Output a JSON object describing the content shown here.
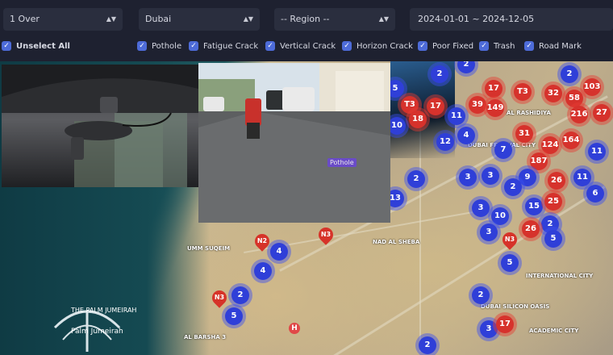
{
  "filters": {
    "severity": "1 Over",
    "city": "Dubai",
    "region": "-- Region --",
    "date_range": "2024-01-01 ~ 2024-12-05"
  },
  "checkboxes": [
    {
      "label": "Unselect All",
      "checked": true
    },
    {
      "label": "Pothole",
      "checked": true
    },
    {
      "label": "Fatigue Crack",
      "checked": true
    },
    {
      "label": "Vertical Crack",
      "checked": true
    },
    {
      "label": "Horizon Crack",
      "checked": true
    },
    {
      "label": "Poor Fixed",
      "checked": true
    },
    {
      "label": "Trash",
      "checked": true
    },
    {
      "label": "Road Mark",
      "checked": true
    }
  ],
  "video": {
    "detection_label": "Pothole"
  },
  "map": {
    "labels": [
      "THE PALM JUMEIRAH",
      "Palm Jumeirah",
      "UMM SUQEIM",
      "AL BARSHA 3",
      "NAD AL SHEBA",
      "DUBAI SILICON OASIS",
      "INTERNATIONAL CITY",
      "ACADEMIC CITY",
      "AL RASHIDIYA",
      "DUBAI FESTIVAL CITY"
    ],
    "clusters": [
      {
        "n": "2",
        "c": "blue"
      },
      {
        "n": "5",
        "c": "blue"
      },
      {
        "n": "2",
        "c": "blue"
      },
      {
        "n": "17",
        "c": "red"
      },
      {
        "n": "T3",
        "c": "red"
      },
      {
        "n": "2",
        "c": "blue"
      },
      {
        "n": "103",
        "c": "red"
      },
      {
        "n": "T3",
        "c": "red"
      },
      {
        "n": "17",
        "c": "red"
      },
      {
        "n": "39",
        "c": "red"
      },
      {
        "n": "149",
        "c": "red"
      },
      {
        "n": "32",
        "c": "red"
      },
      {
        "n": "58",
        "c": "red"
      },
      {
        "n": "216",
        "c": "red"
      },
      {
        "n": "27",
        "c": "red"
      },
      {
        "n": "18",
        "c": "red"
      },
      {
        "n": "11",
        "c": "blue"
      },
      {
        "n": "10",
        "c": "blue"
      },
      {
        "n": "4",
        "c": "blue"
      },
      {
        "n": "31",
        "c": "red"
      },
      {
        "n": "124",
        "c": "red"
      },
      {
        "n": "164",
        "c": "red"
      },
      {
        "n": "12",
        "c": "blue"
      },
      {
        "n": "7",
        "c": "blue"
      },
      {
        "n": "187",
        "c": "red"
      },
      {
        "n": "11",
        "c": "blue"
      },
      {
        "n": "2",
        "c": "blue"
      },
      {
        "n": "3",
        "c": "blue"
      },
      {
        "n": "3",
        "c": "blue"
      },
      {
        "n": "9",
        "c": "blue"
      },
      {
        "n": "26",
        "c": "red"
      },
      {
        "n": "11",
        "c": "blue"
      },
      {
        "n": "2",
        "c": "blue"
      },
      {
        "n": "6",
        "c": "blue"
      },
      {
        "n": "13",
        "c": "blue"
      },
      {
        "n": "3",
        "c": "blue"
      },
      {
        "n": "15",
        "c": "blue"
      },
      {
        "n": "25",
        "c": "red"
      },
      {
        "n": "10",
        "c": "blue"
      },
      {
        "n": "2",
        "c": "blue"
      },
      {
        "n": "3",
        "c": "blue"
      },
      {
        "n": "26",
        "c": "red"
      },
      {
        "n": "5",
        "c": "blue"
      },
      {
        "n": "4",
        "c": "blue"
      },
      {
        "n": "4",
        "c": "blue"
      },
      {
        "n": "5",
        "c": "blue"
      },
      {
        "n": "2",
        "c": "blue"
      },
      {
        "n": "5",
        "c": "blue"
      },
      {
        "n": "2",
        "c": "blue"
      },
      {
        "n": "3",
        "c": "blue"
      },
      {
        "n": "17",
        "c": "red"
      },
      {
        "n": "2",
        "c": "blue"
      }
    ],
    "pins": [
      "N2",
      "N3",
      "N3",
      "N3"
    ],
    "hospital_icon": "H"
  },
  "colors": {
    "cluster_blue": "#2f3fd8",
    "cluster_red": "#d6322c",
    "checkbox": "#4d6bd8"
  }
}
